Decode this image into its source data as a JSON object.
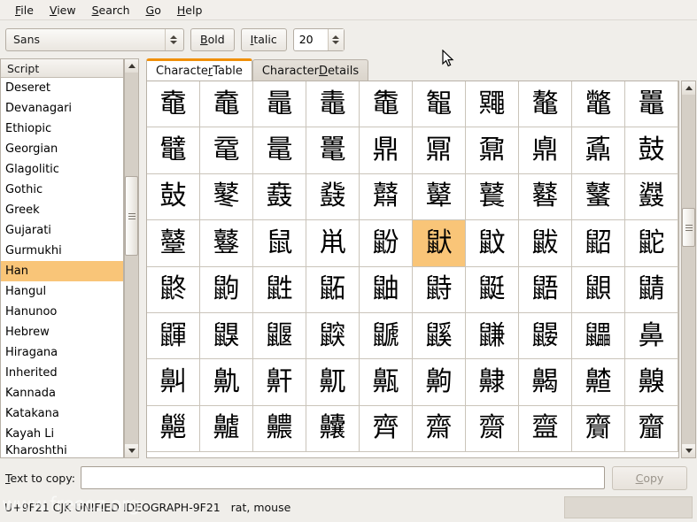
{
  "menubar": {
    "items": [
      {
        "mnemonic": "F",
        "rest": "ile"
      },
      {
        "mnemonic": "V",
        "rest": "iew"
      },
      {
        "mnemonic": "S",
        "rest": "earch"
      },
      {
        "mnemonic": "G",
        "rest": "o"
      },
      {
        "mnemonic": "H",
        "rest": "elp"
      }
    ]
  },
  "toolbar": {
    "font_family": "Sans",
    "bold_mnemonic": "B",
    "bold_rest": "old",
    "italic_mnemonic": "I",
    "italic_rest": "talic",
    "font_size": "20"
  },
  "sidebar": {
    "header": "Script",
    "items": [
      {
        "label": "Deseret",
        "selected": false
      },
      {
        "label": "Devanagari",
        "selected": false
      },
      {
        "label": "Ethiopic",
        "selected": false
      },
      {
        "label": "Georgian",
        "selected": false
      },
      {
        "label": "Glagolitic",
        "selected": false
      },
      {
        "label": "Gothic",
        "selected": false
      },
      {
        "label": "Greek",
        "selected": false
      },
      {
        "label": "Gujarati",
        "selected": false
      },
      {
        "label": "Gurmukhi",
        "selected": false
      },
      {
        "label": "Han",
        "selected": true
      },
      {
        "label": "Hangul",
        "selected": false
      },
      {
        "label": "Hanunoo",
        "selected": false
      },
      {
        "label": "Hebrew",
        "selected": false
      },
      {
        "label": "Hiragana",
        "selected": false
      },
      {
        "label": "Inherited",
        "selected": false
      },
      {
        "label": "Kannada",
        "selected": false
      },
      {
        "label": "Katakana",
        "selected": false
      },
      {
        "label": "Kayah Li",
        "selected": false
      },
      {
        "label": "Kharoshthi",
        "selected": false
      }
    ]
  },
  "notebook": {
    "tabs": [
      {
        "pre": "Characte",
        "mnemonic": "r",
        "post": " Table",
        "active": true
      },
      {
        "pre": "Character ",
        "mnemonic": "D",
        "post": "etails",
        "active": false
      }
    ]
  },
  "chargrid": {
    "columns": 10,
    "selected_index": 35,
    "characters": [
      "鼀",
      "鼁",
      "鼂",
      "鼃",
      "鼄",
      "鼅",
      "鼆",
      "鼇",
      "鼈",
      "鼉",
      "鼊",
      "鼋",
      "鼌",
      "鼍",
      "鼎",
      "鼏",
      "鼐",
      "鼑",
      "鼒",
      "鼓",
      "鼔",
      "鼕",
      "鼖",
      "鼗",
      "鼘",
      "鼙",
      "鼚",
      "鼛",
      "鼜",
      "鼝",
      "鼞",
      "鼟",
      "鼠",
      "鼡",
      "鼢",
      "鼣",
      "鼤",
      "鼥",
      "鼦",
      "鼧",
      "鼨",
      "鼩",
      "鼪",
      "鼫",
      "鼬",
      "鼭",
      "鼮",
      "鼯",
      "鼰",
      "鼱",
      "鼲",
      "鼳",
      "鼴",
      "鼵",
      "鼶",
      "鼷",
      "鼸",
      "鼹",
      "鼺",
      "鼻",
      "鼼",
      "鼽",
      "鼾",
      "鼿",
      "齀",
      "齁",
      "齂",
      "齃",
      "齄",
      "齅",
      "齆",
      "齇",
      "齈",
      "齉",
      "齊",
      "齋",
      "齌",
      "齍",
      "齎",
      "齏"
    ]
  },
  "copybar": {
    "label_mnemonic": "T",
    "label_rest": "ext to copy:",
    "value": "",
    "copy_mnemonic": "C",
    "copy_rest": "opy"
  },
  "statusbar": {
    "text": "U+9F21 CJK UNIFIED IDEOGRAPH-9F21   rat, mouse",
    "watermark": "www.freeoz.org"
  },
  "colors": {
    "selection": "#f9c578",
    "active_tab_accent": "#f0900a",
    "window_bg": "#f0eeea"
  }
}
